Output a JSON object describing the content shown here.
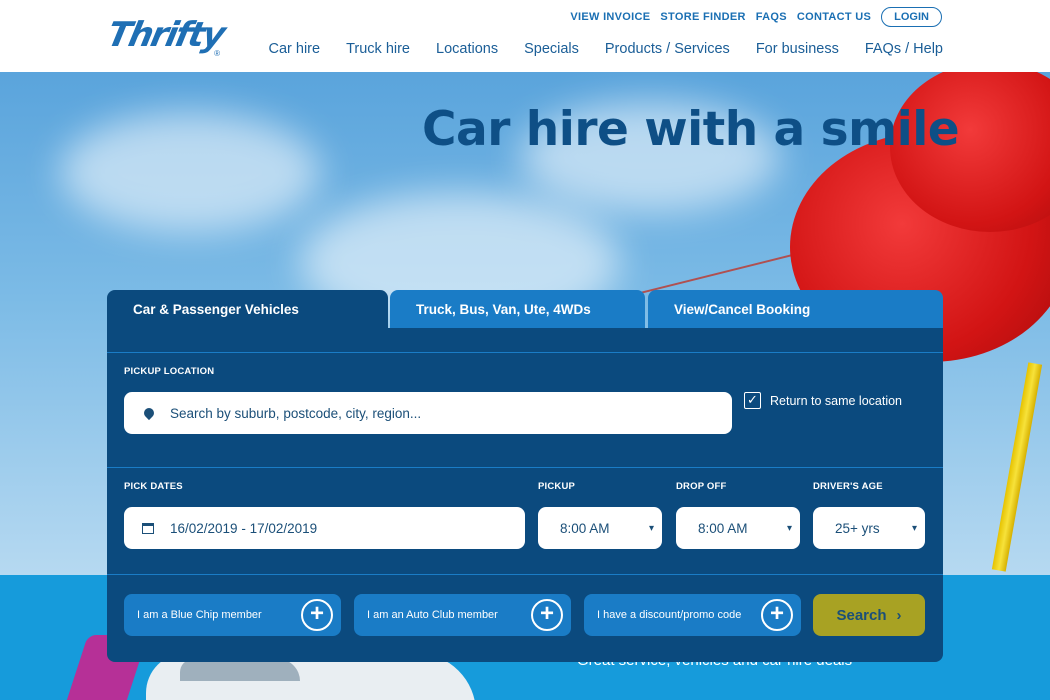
{
  "header": {
    "logo_text": "Thrifty",
    "logo_reg": "®",
    "utility_links": [
      "VIEW INVOICE",
      "STORE FINDER",
      "FAQS",
      "CONTACT US"
    ],
    "login_label": "LOGIN",
    "nav": [
      "Car hire",
      "Truck hire",
      "Locations",
      "Specials",
      "Products / Services",
      "For business",
      "FAQs / Help"
    ]
  },
  "hero": {
    "title": "Car hire with a smile"
  },
  "booking": {
    "tabs": [
      "Car & Passenger Vehicles",
      "Truck, Bus, Van, Ute, 4WDs",
      "View/Cancel Booking"
    ],
    "active_tab": 0,
    "pickup_location_label": "PICKUP LOCATION",
    "location_placeholder": "Search by suburb, postcode, city, region...",
    "return_same_label": "Return to same location",
    "return_same_checked": "✓",
    "pick_dates_label": "PICK DATES",
    "dates_value": "16/02/2019 - 17/02/2019",
    "pickup_label": "PICKUP",
    "pickup_value": "8:00 AM",
    "dropoff_label": "DROP OFF",
    "dropoff_value": "8:00 AM",
    "age_label": "DRIVER'S AGE",
    "age_value": "25+ yrs",
    "caret": "▾",
    "options": [
      "I am a Blue Chip member",
      "I am an Auto Club member",
      "I have a discount/promo code"
    ],
    "plus": "+",
    "search_label": "Search",
    "search_chevron": "›"
  },
  "lower": {
    "text": "Great service, vehicles and car hire deals"
  },
  "colors": {
    "brand_blue": "#1a6fb3",
    "panel_blue": "#0b4a7e",
    "tab_blue": "#1a7cc6",
    "search_olive": "#a8a223"
  }
}
